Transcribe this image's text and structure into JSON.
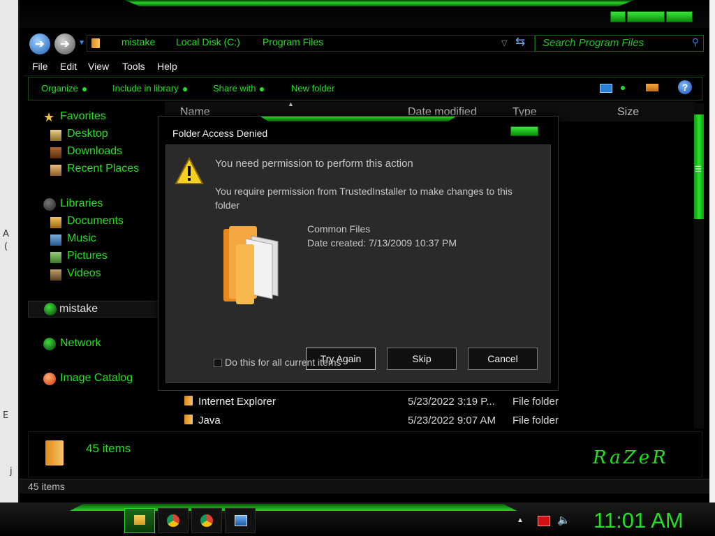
{
  "colors": {
    "accent": "#22e022",
    "background": "#000000",
    "dialog_body": "#2a2a2a"
  },
  "desktop_left": {
    "chars": [
      "A",
      "(",
      "E",
      "j"
    ]
  },
  "address_bar": {
    "crumbs": [
      "mistake",
      "Local Disk (C:)",
      "Program Files"
    ],
    "search_placeholder": "Search Program Files"
  },
  "menu": [
    "File",
    "Edit",
    "View",
    "Tools",
    "Help"
  ],
  "commands": [
    "Organize",
    "Include in library",
    "Share with",
    "New folder"
  ],
  "nav_pane": {
    "favorites_header": "Favorites",
    "favorites": [
      "Desktop",
      "Downloads",
      "Recent Places"
    ],
    "libraries_header": "Libraries",
    "libraries": [
      "Documents",
      "Music",
      "Pictures",
      "Videos"
    ],
    "homegroup": "mistake",
    "network": "Network",
    "image_catalog": "Image Catalog"
  },
  "columns": [
    "Name",
    "Date modified",
    "Type",
    "Size"
  ],
  "rows": [
    {
      "name": "Internet Explorer",
      "date": "5/23/2022 3:19 P...",
      "type": "File folder"
    },
    {
      "name": "Java",
      "date": "5/23/2022 9:07 AM",
      "type": "File folder"
    }
  ],
  "details": {
    "count": "45 items",
    "brand": "RaZeR"
  },
  "status": {
    "count": "45 items"
  },
  "dialog": {
    "title": "Folder Access Denied",
    "heading": "You need permission to perform this action",
    "message_line1": "You require permission from TrustedInstaller to make changes to this",
    "message_line2": "folder",
    "item_name": "Common Files",
    "item_date": "Date created: 7/13/2009 10:37 PM",
    "try_again": "Try Again",
    "skip": "Skip",
    "cancel": "Cancel",
    "checkbox_label": "Do this for all current items"
  },
  "taskbar": {
    "clock": "11:01 AM"
  }
}
